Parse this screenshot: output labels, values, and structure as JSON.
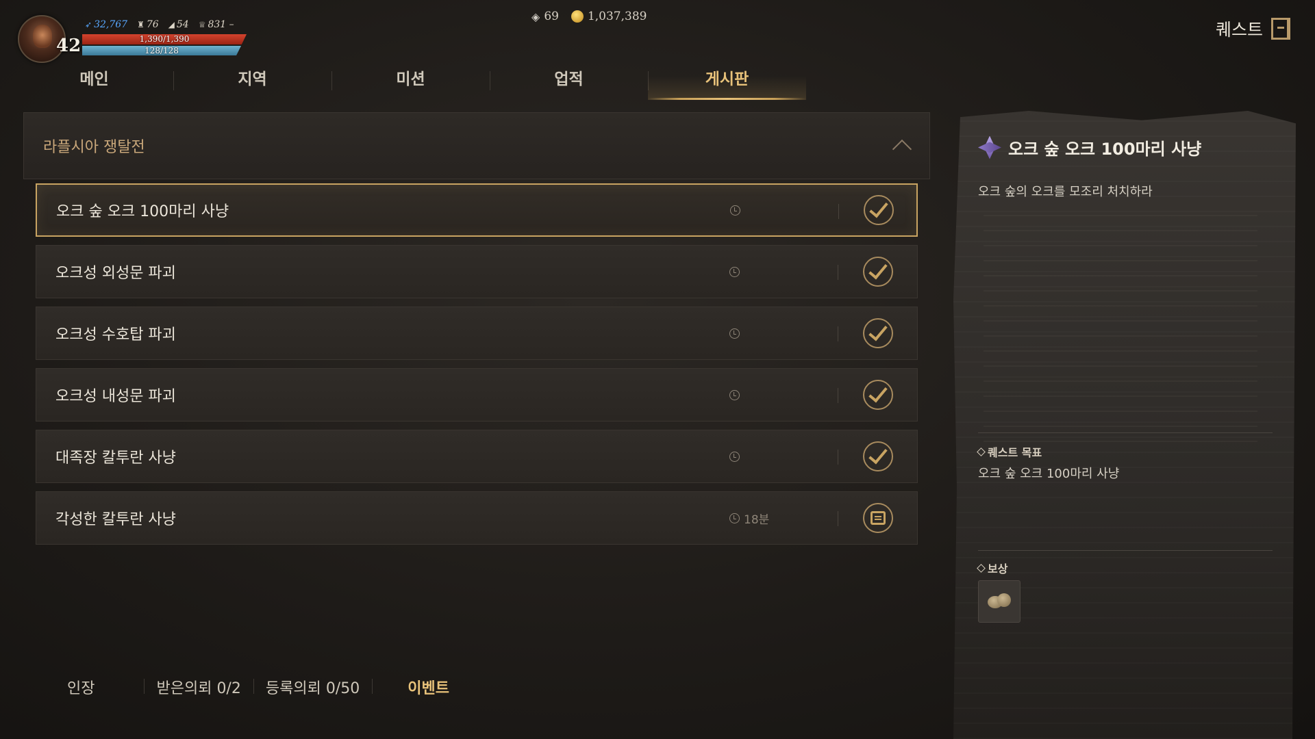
{
  "player": {
    "level": "42",
    "stats": [
      {
        "icon": "feather-icon",
        "value": "32,767",
        "color": "#58a8ff"
      },
      {
        "icon": "armor-icon",
        "value": "76"
      },
      {
        "icon": "wing-icon",
        "value": "54"
      },
      {
        "icon": "trophy-icon",
        "value": "831 –"
      }
    ],
    "hp": "1,390/1,390",
    "mp": "128/128"
  },
  "currency": {
    "gems": "69",
    "gold": "1,037,389"
  },
  "header": {
    "title": "퀘스트"
  },
  "tabs": [
    "메인",
    "지역",
    "미션",
    "업적",
    "게시판"
  ],
  "active_tab": "게시판",
  "group": {
    "title": "라플시아 쟁탈전"
  },
  "quests": [
    {
      "name": "오크 숲 오크 100마리 사냥",
      "timer": "",
      "action": "check-icon",
      "selected": true
    },
    {
      "name": "오크성 외성문 파괴",
      "timer": "",
      "action": "check-icon"
    },
    {
      "name": "오크성 수호탑 파괴",
      "timer": "",
      "action": "check-icon"
    },
    {
      "name": "오크성 내성문 파괴",
      "timer": "",
      "action": "check-icon"
    },
    {
      "name": "대족장 칼투란 사냥",
      "timer": "",
      "action": "check-icon"
    },
    {
      "name": "각성한 칼투란 사냥",
      "timer": "18분",
      "action": "scroll-icon"
    }
  ],
  "bottom": {
    "seal": "인장",
    "received": "받은의뢰 0/2",
    "registered": "등록의뢰 0/50",
    "event": "이벤트"
  },
  "detail": {
    "title": "오크 숲 오크 100마리 사냥",
    "description": "오크 숲의 오크를 모조리 처치하라",
    "objective_label": "퀘스트 목표",
    "objective": "오크 숲 오크 100마리 사냥",
    "reward_label": "보상",
    "reward_icon": "coins-icon"
  },
  "colors": {
    "accent_gold": "#e8c27a",
    "hp_red": "#d4432e",
    "mp_blue": "#6fb3cf",
    "stat_blue": "#58a8ff"
  }
}
